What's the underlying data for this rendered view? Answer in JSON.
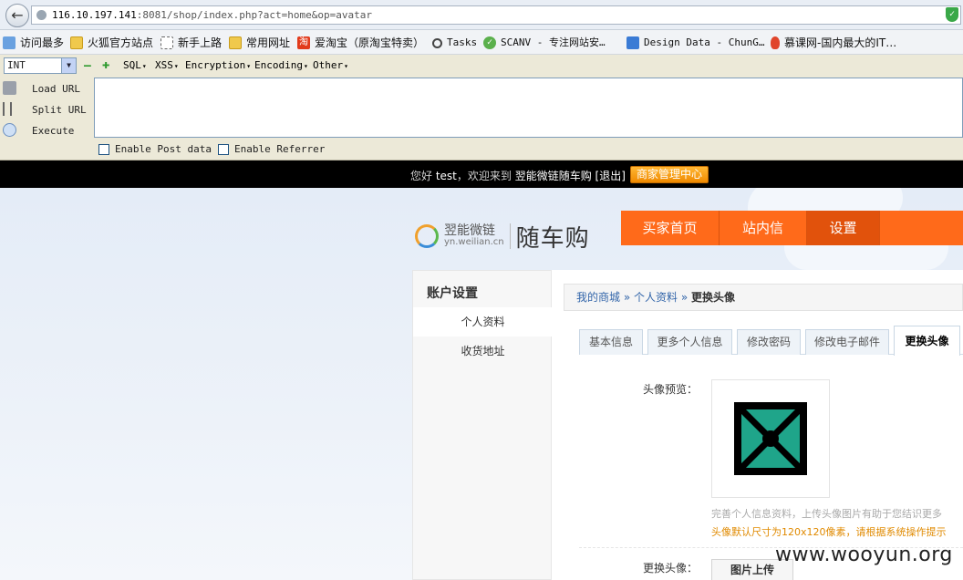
{
  "browser": {
    "url_host": "116.10.197.141",
    "url_rest": ":8081/shop/index.php?act=home&op=avatar",
    "back_glyph": "←",
    "shield_glyph": "✓"
  },
  "bookmarks": [
    {
      "label": "访问最多",
      "icon": "search-icon"
    },
    {
      "label": "火狐官方站点",
      "icon": "folder-icon"
    },
    {
      "label": "新手上路",
      "icon": "dashed-page-icon"
    },
    {
      "label": "常用网址",
      "icon": "folder-icon"
    },
    {
      "label": "爱淘宝（原淘宝特卖）",
      "icon": "taobao-icon",
      "glyph": "淘"
    },
    {
      "label": "Tasks",
      "icon": "magnifier-icon"
    },
    {
      "label": "SCANV - 专注网站安…",
      "icon": "check-circle-icon",
      "glyph": "✓"
    },
    {
      "label": "Design Data - ChunG…",
      "icon": "database-icon"
    },
    {
      "label": "慕课网-国内最大的IT…",
      "icon": "flame-icon"
    }
  ],
  "hackbar": {
    "select_value": "INT",
    "menus": [
      "SQL",
      "XSS",
      "Encryption",
      "Encoding",
      "Other"
    ],
    "load_url": "Load URL",
    "split_url": "Split URL",
    "execute": "Execute",
    "enable_post": "Enable Post data",
    "enable_referrer": "Enable Referrer"
  },
  "topbar": {
    "greeting": "您好 ",
    "user": "test",
    "welcome": "，欢迎来到 ",
    "site": "翌能微链随车购",
    "logout": " [退出]",
    "merchant_btn": "商家管理中心"
  },
  "logo": {
    "cn": "翌能微链",
    "en": "yn.weilian.cn",
    "sub": "随车购"
  },
  "nav": [
    "买家首页",
    "站内信",
    "设置"
  ],
  "sidebar": {
    "title": "账户设置",
    "items": [
      "个人资料",
      "收货地址"
    ]
  },
  "breadcrumb": {
    "home": "我的商城",
    "sep": " » ",
    "profile": "个人资料",
    "current": "更换头像"
  },
  "tabs": [
    "基本信息",
    "更多个人信息",
    "修改密码",
    "修改电子邮件",
    "更换头像"
  ],
  "avatar_section": {
    "preview_label": "头像预览：",
    "hint1": "完善个人信息资料，上传头像图片有助于您结识更多",
    "hint2": "头像默认尺寸为120x120像素，请根据系统操作提示",
    "change_label": "更换头像：",
    "upload_btn": "图片上传"
  },
  "watermark": "www.wooyun.org"
}
